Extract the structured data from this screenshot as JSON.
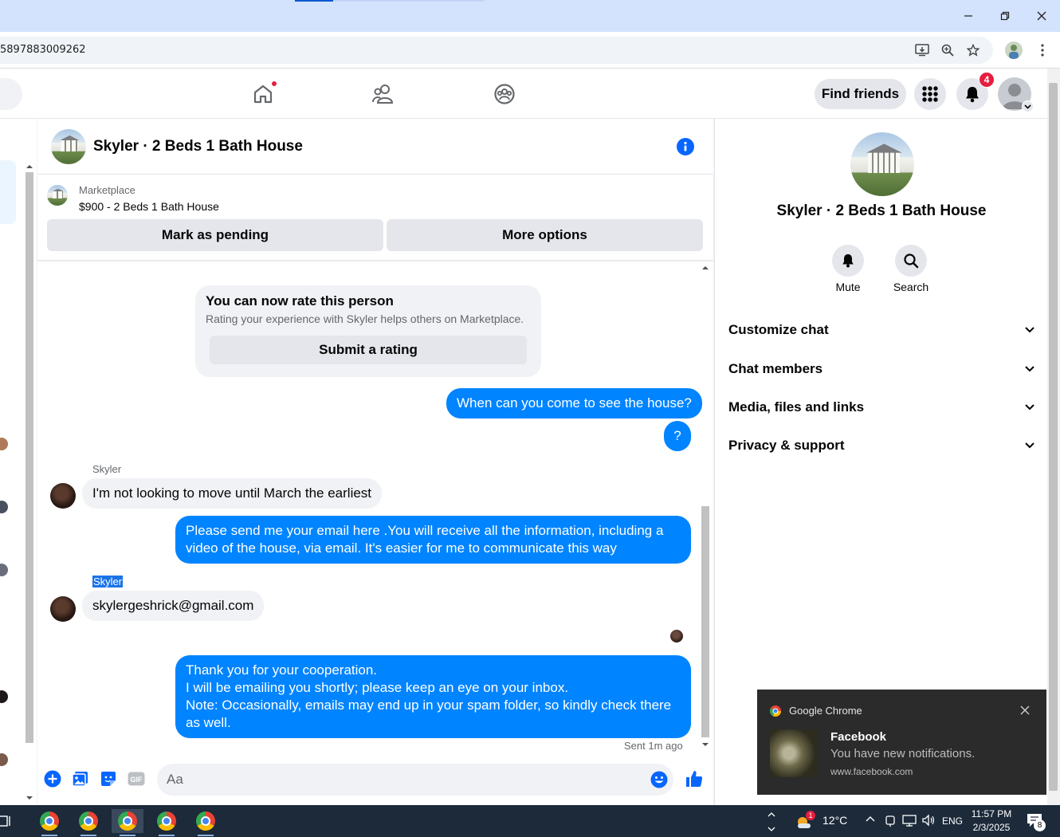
{
  "browser": {
    "url_fragment": "5897883009262"
  },
  "topnav": {
    "find_friends": "Find friends",
    "notification_count": "4"
  },
  "chat": {
    "title": "Skyler · 2 Beds 1 Bath House",
    "marketplace_label": "Marketplace",
    "listing": "$900 - 2 Beds 1 Bath House",
    "mark_pending": "Mark as pending",
    "more_options": "More options",
    "rate_card": {
      "title": "You can now rate this person",
      "subtitle": "Rating your experience with Skyler helps others on Marketplace.",
      "button": "Submit a rating"
    },
    "messages": [
      {
        "from": "me",
        "text": "When can you come to see the house?"
      },
      {
        "from": "me",
        "text": "?"
      },
      {
        "from": "Skyler",
        "sender_label": "Skyler",
        "text": "I'm not looking to move until March the earliest"
      },
      {
        "from": "me",
        "text": "Please send me your email here .You will receive all the information, including a video of the house, via email. It's easier for me to communicate this way"
      },
      {
        "from": "Skyler",
        "sender_label": "Skyler",
        "text": "skylergeshrick@gmail.com"
      },
      {
        "from": "me",
        "lines": [
          "Thank you for your cooperation.",
          "I will be emailing you shortly; please keep an eye on your inbox.",
          "Note: Occasionally, emails may end up in your spam folder, so kindly check there as well."
        ]
      }
    ],
    "sent_status": "Sent 1m ago",
    "composer_placeholder": "Aa"
  },
  "details": {
    "title": "Skyler · 2 Beds 1 Bath House",
    "mute": "Mute",
    "search": "Search",
    "sections": [
      "Customize chat",
      "Chat members",
      "Media, files and links",
      "Privacy & support"
    ]
  },
  "notification": {
    "app": "Google Chrome",
    "title": "Facebook",
    "body": "You have new notifications.",
    "source": "www.facebook.com"
  },
  "taskbar": {
    "weather_badge": "1",
    "temperature": "12°C",
    "language": "ENG",
    "time": "11:57 PM",
    "date": "2/3/2025",
    "notif_count": "8"
  },
  "colors": {
    "accent": "#0866ff",
    "outgoing_bubble": "#0084ff",
    "incoming_bubble": "#f0f2f5",
    "badge": "#e41e3f"
  }
}
